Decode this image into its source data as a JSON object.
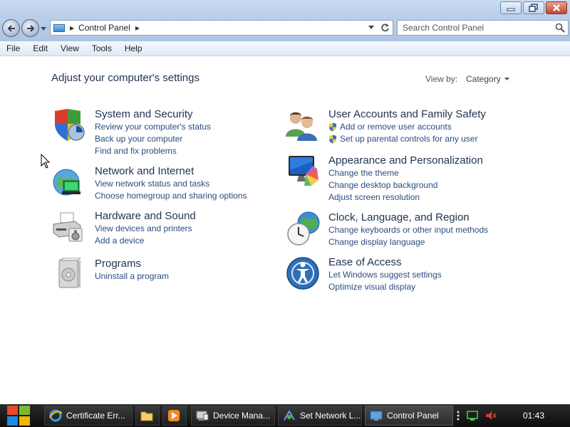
{
  "window": {
    "buttons": [
      "minimize",
      "restore",
      "close"
    ]
  },
  "address": {
    "breadcrumb": "Control Panel",
    "search_placeholder": "Search Control Panel"
  },
  "menu": [
    "File",
    "Edit",
    "View",
    "Tools",
    "Help"
  ],
  "main": {
    "title": "Adjust your computer's settings",
    "view_by_label": "View by:",
    "view_by_value": "Category",
    "categories": [
      {
        "title": "System and Security",
        "icon": "shield-icon",
        "links": [
          "Review your computer's status",
          "Back up your computer",
          "Find and fix problems"
        ]
      },
      {
        "title": "Network and Internet",
        "icon": "network-icon",
        "links": [
          "View network status and tasks",
          "Choose homegroup and sharing options"
        ]
      },
      {
        "title": "Hardware and Sound",
        "icon": "printer-icon",
        "links": [
          "View devices and printers",
          "Add a device"
        ]
      },
      {
        "title": "Programs",
        "icon": "programs-icon",
        "links": [
          "Uninstall a program"
        ]
      },
      {
        "title": "User Accounts and Family Safety",
        "icon": "users-icon",
        "links": [
          "Add or remove user accounts",
          "Set up parental controls for any user"
        ]
      },
      {
        "title": "Appearance and Personalization",
        "icon": "monitor-icon",
        "links": [
          "Change the theme",
          "Change desktop background",
          "Adjust screen resolution"
        ]
      },
      {
        "title": "Clock, Language, and Region",
        "icon": "clock-globe-icon",
        "links": [
          "Change keyboards or other input methods",
          "Change display language"
        ]
      },
      {
        "title": "Ease of Access",
        "icon": "ease-of-access-icon",
        "links": [
          "Let Windows suggest settings",
          "Optimize visual display"
        ]
      }
    ]
  },
  "taskbar": {
    "tasks": [
      {
        "label": "Certificate Err...",
        "icon": "ie-icon"
      },
      {
        "label": "",
        "icon": "folder-icon"
      },
      {
        "label": "",
        "icon": "media-player-icon"
      },
      {
        "label": "Device Mana...",
        "icon": "device-manager-icon"
      },
      {
        "label": "Set Network L...",
        "icon": "network-location-icon"
      },
      {
        "label": "Control Panel",
        "icon": "control-panel-icon"
      }
    ],
    "clock": "01:43"
  },
  "colors": {
    "link": "#2a4d80",
    "heading": "#1e3250",
    "titlebar": "#b7cde9"
  }
}
